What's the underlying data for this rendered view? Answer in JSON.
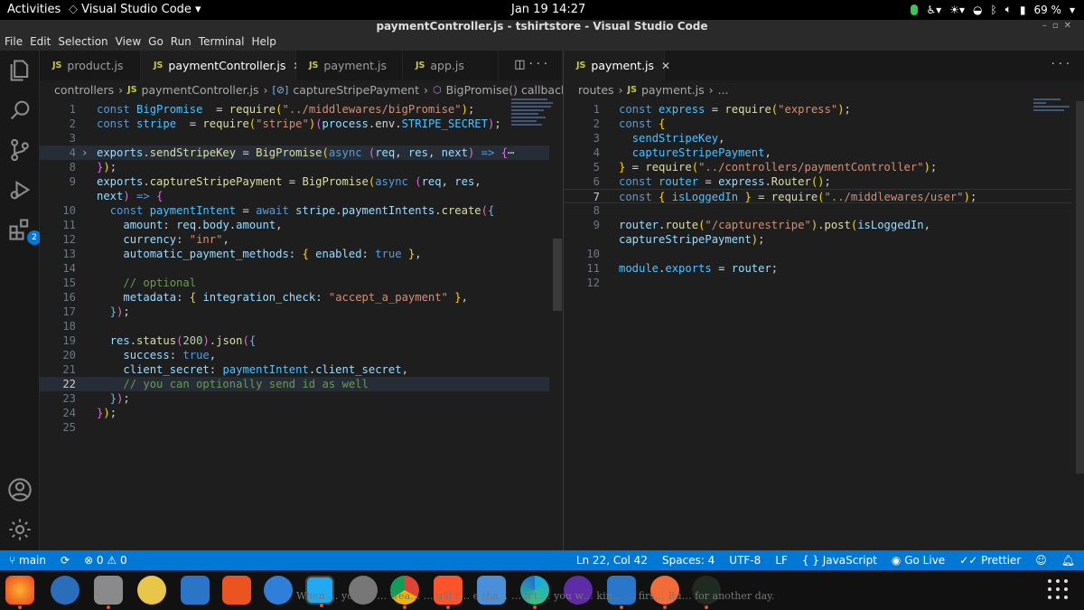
{
  "system": {
    "activities": "Activities",
    "app_menu": "Visual Studio Code ▾",
    "clock": "Jan 19  14:27",
    "battery": "69 %"
  },
  "window": {
    "title": "paymentController.js - tshirtstore - Visual Studio Code"
  },
  "menu": [
    "File",
    "Edit",
    "Selection",
    "View",
    "Go",
    "Run",
    "Terminal",
    "Help"
  ],
  "activity_badge": "2",
  "left": {
    "tabs": [
      {
        "label": "product.js",
        "active": false
      },
      {
        "label": "paymentController.js",
        "active": true
      },
      {
        "label": "payment.js",
        "active": false
      },
      {
        "label": "app.js",
        "active": false
      }
    ],
    "breadcrumb": [
      "controllers",
      "paymentController.js",
      "captureStripePayment",
      "BigPromise() callback"
    ],
    "lines": [
      {
        "n": "1",
        "tokens": [
          [
            "k",
            "const "
          ],
          [
            "c",
            "BigPromise"
          ],
          [
            "",
            "  = "
          ],
          [
            "f",
            "require"
          ],
          [
            "y",
            "("
          ],
          [
            "s",
            "\"../middlewares/bigPromise\""
          ],
          [
            "y",
            ")"
          ],
          [
            "",
            ";"
          ]
        ]
      },
      {
        "n": "2",
        "tokens": [
          [
            "k",
            "const "
          ],
          [
            "c",
            "stripe"
          ],
          [
            "",
            "  = "
          ],
          [
            "f",
            "require"
          ],
          [
            "y",
            "("
          ],
          [
            "s",
            "\"stripe\""
          ],
          [
            "y",
            ")"
          ],
          [
            "p",
            "("
          ],
          [
            "v",
            "process"
          ],
          [
            "",
            ""
          ],
          [
            "",
            ".env."
          ],
          [
            "c",
            "STRIPE_SECRET"
          ],
          [
            "p",
            ")"
          ],
          [
            "",
            ";"
          ]
        ]
      },
      {
        "n": "3",
        "tokens": []
      },
      {
        "n": "4",
        "tokens": [
          [
            "v",
            "exports"
          ],
          [
            "",
            "."
          ],
          [
            "f",
            "sendStripeKey"
          ],
          [
            "",
            " = "
          ],
          [
            "f",
            "BigPromise"
          ],
          [
            "y",
            "("
          ],
          [
            "k",
            "async"
          ],
          [
            "",
            " "
          ],
          [
            "p",
            "("
          ],
          [
            "v",
            "req"
          ],
          [
            ", "
          ],
          [
            "v",
            "res"
          ],
          [
            ", "
          ],
          [
            "v",
            "next"
          ],
          [
            "p",
            ")"
          ],
          [
            "",
            " "
          ],
          [
            "k",
            "=>"
          ],
          [
            "",
            " "
          ],
          [
            "p",
            "{"
          ],
          [
            "",
            "⋯"
          ]
        ]
      },
      {
        "n": "8",
        "tokens": [
          [
            "p",
            "}"
          ],
          [
            "y",
            ")"
          ],
          [
            "",
            ";"
          ]
        ]
      },
      {
        "n": "9",
        "tokens": [
          [
            "v",
            "exports"
          ],
          [
            "",
            "."
          ],
          [
            "f",
            "captureStripePayment"
          ],
          [
            "",
            " = "
          ],
          [
            "f",
            "BigPromise"
          ],
          [
            "y",
            "("
          ],
          [
            "k",
            "async"
          ],
          [
            "",
            " "
          ],
          [
            "p",
            "("
          ],
          [
            "v",
            "req"
          ],
          [
            ", "
          ],
          [
            "v",
            "res"
          ],
          [
            ","
          ]
        ]
      },
      {
        "n": "",
        "tokens": [
          [
            "v",
            "next"
          ],
          [
            "p",
            ")"
          ],
          [
            "",
            " "
          ],
          [
            "k",
            "=>"
          ],
          [
            "",
            " "
          ],
          [
            "p",
            "{"
          ]
        ]
      },
      {
        "n": "10",
        "tokens": [
          [
            "",
            "  "
          ],
          [
            "k",
            "const "
          ],
          [
            "c",
            "paymentIntent"
          ],
          [
            "",
            " = "
          ],
          [
            "k",
            "await "
          ],
          [
            "v",
            "stripe"
          ],
          [
            "",
            "."
          ],
          [
            "v",
            "paymentIntents"
          ],
          [
            "",
            "."
          ],
          [
            "f",
            "create"
          ],
          [
            "p",
            "("
          ],
          [
            "c",
            "{"
          ]
        ]
      },
      {
        "n": "11",
        "tokens": [
          [
            "",
            "    "
          ],
          [
            "v",
            "amount"
          ],
          [
            ": "
          ],
          [
            "v",
            "req"
          ],
          [
            "",
            "."
          ],
          [
            "v",
            "body"
          ],
          [
            "",
            "."
          ],
          [
            "v",
            "amount"
          ],
          [
            ","
          ]
        ]
      },
      {
        "n": "12",
        "tokens": [
          [
            "",
            "    "
          ],
          [
            "v",
            "currency"
          ],
          [
            ": "
          ],
          [
            "s",
            "\"inr\""
          ],
          [
            ","
          ]
        ]
      },
      {
        "n": "13",
        "tokens": [
          [
            "",
            "    "
          ],
          [
            "v",
            "automatic_payment_methods"
          ],
          [
            ": "
          ],
          [
            "y",
            "{ "
          ],
          [
            "v",
            "enabled"
          ],
          [
            ": "
          ],
          [
            "k",
            "true"
          ],
          [
            " "
          ],
          [
            "y",
            "}"
          ],
          [
            ","
          ]
        ]
      },
      {
        "n": "14",
        "tokens": []
      },
      {
        "n": "15",
        "tokens": [
          [
            "",
            "    "
          ],
          [
            "cm",
            "// optional"
          ]
        ]
      },
      {
        "n": "16",
        "tokens": [
          [
            "",
            "    "
          ],
          [
            "v",
            "metadata"
          ],
          [
            ": "
          ],
          [
            "y",
            "{ "
          ],
          [
            "v",
            "integration_check"
          ],
          [
            ": "
          ],
          [
            "s",
            "\"accept_a_payment\""
          ],
          [
            " "
          ],
          [
            "y",
            "}"
          ],
          [
            ","
          ]
        ]
      },
      {
        "n": "17",
        "tokens": [
          [
            "",
            "  "
          ],
          [
            "c",
            "}"
          ],
          [
            "p",
            ")"
          ],
          [
            "",
            ";"
          ]
        ]
      },
      {
        "n": "18",
        "tokens": []
      },
      {
        "n": "19",
        "tokens": [
          [
            "",
            "  "
          ],
          [
            "v",
            "res"
          ],
          [
            "",
            "."
          ],
          [
            "f",
            "status"
          ],
          [
            "p",
            "("
          ],
          [
            "n",
            "200"
          ],
          [
            "p",
            ")"
          ],
          [
            "",
            "."
          ],
          [
            "f",
            "json"
          ],
          [
            "p",
            "("
          ],
          [
            "c",
            "{"
          ]
        ]
      },
      {
        "n": "20",
        "tokens": [
          [
            "",
            "    "
          ],
          [
            "v",
            "success"
          ],
          [
            ": "
          ],
          [
            "k",
            "true"
          ],
          [
            ","
          ]
        ]
      },
      {
        "n": "21",
        "tokens": [
          [
            "",
            "    "
          ],
          [
            "v",
            "client_secret"
          ],
          [
            ": "
          ],
          [
            "c",
            "paymentIntent"
          ],
          [
            "",
            "."
          ],
          [
            "v",
            "client_secret"
          ],
          [
            ","
          ]
        ]
      },
      {
        "n": "22",
        "tokens": [
          [
            "",
            "    "
          ],
          [
            "cm",
            "// you can optionally send id as well"
          ]
        ]
      },
      {
        "n": "23",
        "tokens": [
          [
            "",
            "  "
          ],
          [
            "c",
            "}"
          ],
          [
            "p",
            ")"
          ],
          [
            "",
            ";"
          ]
        ]
      },
      {
        "n": "24",
        "tokens": [
          [
            "p",
            "}"
          ],
          [
            "y",
            ")"
          ],
          [
            "",
            ";"
          ]
        ]
      },
      {
        "n": "25",
        "tokens": []
      }
    ]
  },
  "right": {
    "tabs": [
      {
        "label": "payment.js",
        "active": true
      }
    ],
    "breadcrumb": [
      "routes",
      "payment.js",
      "..."
    ],
    "lines": [
      {
        "n": "1",
        "tokens": [
          [
            "k",
            "const "
          ],
          [
            "c",
            "express"
          ],
          [
            "",
            " = "
          ],
          [
            "f",
            "require"
          ],
          [
            "y",
            "("
          ],
          [
            "s",
            "\"express\""
          ],
          [
            "y",
            ")"
          ],
          [
            "",
            ";"
          ]
        ]
      },
      {
        "n": "2",
        "tokens": [
          [
            "k",
            "const "
          ],
          [
            "y",
            "{"
          ]
        ]
      },
      {
        "n": "3",
        "tokens": [
          [
            "",
            "  "
          ],
          [
            "c",
            "sendStripeKey"
          ],
          [
            ","
          ]
        ]
      },
      {
        "n": "4",
        "tokens": [
          [
            "",
            "  "
          ],
          [
            "c",
            "captureStripePayment"
          ],
          [
            ","
          ]
        ]
      },
      {
        "n": "5",
        "tokens": [
          [
            "y",
            "}"
          ],
          [
            "",
            " = "
          ],
          [
            "f",
            "require"
          ],
          [
            "y",
            "("
          ],
          [
            "s",
            "\"../controllers/paymentController\""
          ],
          [
            "y",
            ")"
          ],
          [
            "",
            ";"
          ]
        ]
      },
      {
        "n": "6",
        "tokens": [
          [
            "k",
            "const "
          ],
          [
            "c",
            "router"
          ],
          [
            "",
            " = "
          ],
          [
            "v",
            "express"
          ],
          [
            "",
            "."
          ],
          [
            "f",
            "Router"
          ],
          [
            "y",
            "()"
          ],
          [
            "",
            ";"
          ]
        ]
      },
      {
        "n": "7",
        "tokens": [
          [
            "k",
            "const "
          ],
          [
            "y",
            "{ "
          ],
          [
            "c",
            "isLoggedIn"
          ],
          [
            " "
          ],
          [
            "y",
            "}"
          ],
          [
            "",
            " = "
          ],
          [
            "f",
            "require"
          ],
          [
            "y",
            "("
          ],
          [
            "s",
            "\"../middlewares/user\""
          ],
          [
            "y",
            ")"
          ],
          [
            "",
            ";"
          ]
        ]
      },
      {
        "n": "8",
        "tokens": []
      },
      {
        "n": "9",
        "tokens": [
          [
            "v",
            "router"
          ],
          [
            "",
            "."
          ],
          [
            "f",
            "route"
          ],
          [
            "y",
            "("
          ],
          [
            "s",
            "\"/capturestripe\""
          ],
          [
            "y",
            ")"
          ],
          [
            "",
            "."
          ],
          [
            "f",
            "post"
          ],
          [
            "y",
            "("
          ],
          [
            "v",
            "isLoggedIn"
          ],
          [
            ","
          ]
        ]
      },
      {
        "n": "",
        "tokens": [
          [
            "v",
            "captureStripePayment"
          ],
          [
            "y",
            ")"
          ],
          [
            "",
            ";"
          ]
        ]
      },
      {
        "n": "10",
        "tokens": []
      },
      {
        "n": "11",
        "tokens": [
          [
            "c",
            "module"
          ],
          [
            "",
            "."
          ],
          [
            "c",
            "exports"
          ],
          [
            "",
            " = "
          ],
          [
            "v",
            "router"
          ],
          [
            "",
            ";"
          ]
        ]
      },
      {
        "n": "12",
        "tokens": []
      }
    ]
  },
  "status": {
    "branch": "main",
    "problems": "⊗ 0 ⚠ 0",
    "position": "Ln 22, Col 42",
    "spaces": "Spaces: 4",
    "encoding": "UTF-8",
    "eol": "LF",
    "language": "{ }  JavaScript",
    "golive": "Go Live",
    "prettier": "✓✓ Prettier"
  },
  "dock_overlay": "When … you've … wea… … u'll r… e tha… … n't … you w… kin… … firs… Bu… for another day."
}
